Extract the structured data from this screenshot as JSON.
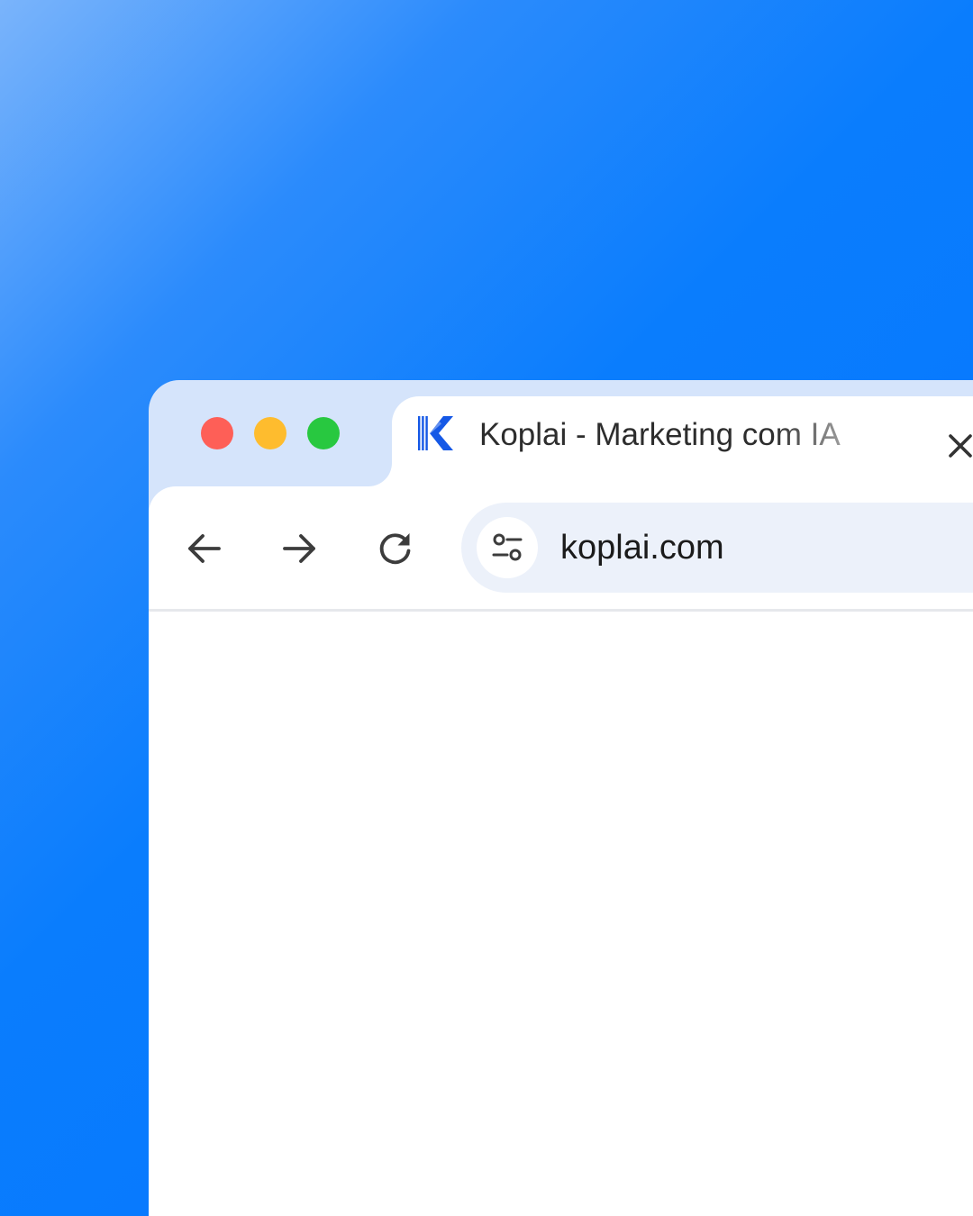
{
  "window": {
    "traffic_lights": [
      {
        "name": "close",
        "color": "#fe5f57"
      },
      {
        "name": "minimize",
        "color": "#febc2e"
      },
      {
        "name": "zoom",
        "color": "#28c840"
      }
    ]
  },
  "tab": {
    "title": "Koplai - Marketing com IA",
    "favicon": "koplai-k-logo",
    "close_icon": "close-icon",
    "brand_color": "#1558e6"
  },
  "toolbar": {
    "back_icon": "arrow-left-icon",
    "forward_icon": "arrow-right-icon",
    "reload_icon": "reload-icon",
    "site_info_icon": "tune-icon",
    "url": "koplai.com"
  },
  "colors": {
    "chrome_frame": "#d5e4fb",
    "address_bar": "#ecf1fa",
    "background_gradient_start": "#7ab4fb",
    "background_gradient_end": "#0677fe"
  }
}
